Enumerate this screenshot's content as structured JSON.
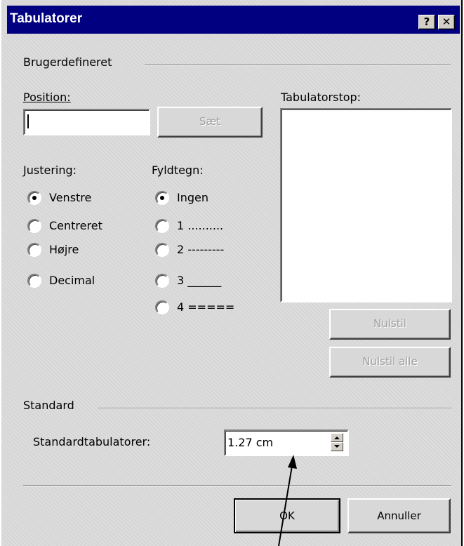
{
  "window": {
    "title": "Tabulatorer",
    "help_label": "?",
    "close_label": "✕"
  },
  "custom_group": {
    "title": "Brugerdefineret",
    "position_label": "Position:",
    "position_value": "",
    "set_button": "Sæt",
    "tabstops_label": "Tabulatorstop:",
    "alignment": {
      "label": "Justering:",
      "options": [
        {
          "label": "Venstre",
          "checked": true
        },
        {
          "label": "Centreret",
          "checked": false
        },
        {
          "label": "Højre",
          "checked": false
        },
        {
          "label": "Decimal",
          "checked": false
        }
      ]
    },
    "leader": {
      "label": "Fyldtegn:",
      "options": [
        {
          "label": "Ingen",
          "checked": true
        },
        {
          "label": "1 ..........",
          "checked": false
        },
        {
          "label": "2 ---------",
          "checked": false
        },
        {
          "label": "3 ______",
          "checked": false
        },
        {
          "label": "4 =====",
          "checked": false
        }
      ]
    },
    "reset_button": "Nulstil",
    "reset_all_button": "Nulstil alle"
  },
  "standard_group": {
    "title": "Standard",
    "default_tabs_label": "Standardtabulatorer:",
    "default_tabs_value": "1.27 cm"
  },
  "buttons": {
    "ok": "OK",
    "cancel": "Annuller"
  }
}
